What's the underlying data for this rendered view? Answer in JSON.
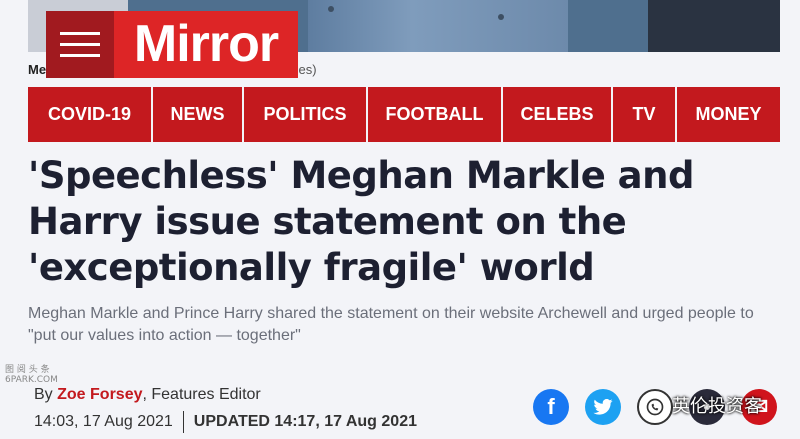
{
  "brand": {
    "logo_text": "Mirror",
    "accent": "#c3191e",
    "logo_bg": "#dd2526"
  },
  "photo_caption": {
    "visible_start": "Meg",
    "visible_end": "ages)"
  },
  "nav": {
    "items": [
      "COVID-19",
      "NEWS",
      "POLITICS",
      "FOOTBALL",
      "CELEBS",
      "TV",
      "MONEY"
    ]
  },
  "article": {
    "headline": "'Speechless' Meghan Markle and Harry issue statement on the 'exceptionally fragile' world",
    "standfirst": "Meghan Markle and Prince Harry shared the statement on their website Archewell and urged people to \"put our values into action — together\"",
    "byline_prefix": "By",
    "author": "Zoe Forsey",
    "author_role": ", Features Editor",
    "published": "14:03, 17 Aug 2021",
    "updated": "UPDATED 14:17, 17 Aug 2021"
  },
  "share": {
    "facebook_icon": "facebook-icon",
    "twitter_icon": "twitter-icon",
    "whatsapp_icon": "whatsapp-icon",
    "other_icon": "share-icon",
    "mail_icon": "email-icon"
  },
  "watermarks": {
    "left": "图 阅 头 条\n6PARK.COM",
    "right": "英伦投资客"
  }
}
